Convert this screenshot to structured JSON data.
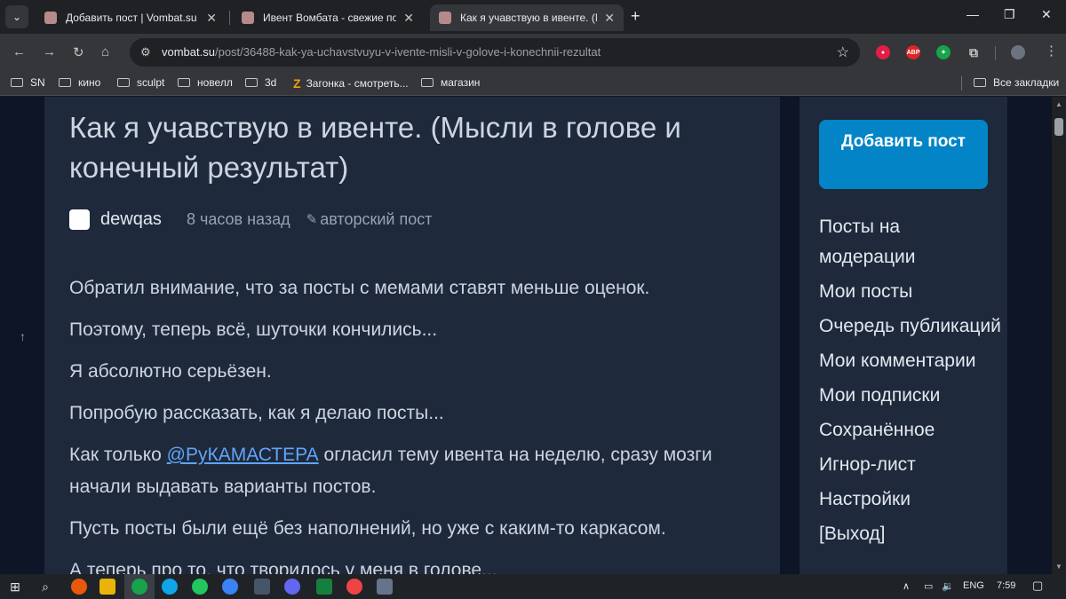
{
  "browser": {
    "tabs": [
      {
        "title": "Добавить пост | Vombat.su",
        "active": false
      },
      {
        "title": "Ивент Вомбата - свежие посты",
        "active": false
      },
      {
        "title": "Как я учавствую в ивенте. (Мыс",
        "active": true
      }
    ],
    "url_host": "vombat.su",
    "url_path": "/post/36488-kak-ya-uchavstvuyu-v-ivente-misli-v-golove-i-konechnii-rezultat",
    "bookmarks": [
      "SN",
      "кино",
      "sculpt",
      "новелл",
      "3d",
      "Загонка - смотреть...",
      "магазин"
    ],
    "all_bookmarks": "Все закладки",
    "extensions": [
      "ABP"
    ]
  },
  "post": {
    "title": "Как я учавствую в ивенте. (Мысли в голове и конечный результат)",
    "author": "dewqas",
    "time": "8 часов назад",
    "badge": "авторский пост",
    "paragraphs": {
      "p1": "Обратил внимание, что за посты с мемами ставят меньше оценок.",
      "p2": "Поэтому, теперь всё, шуточки кончились...",
      "p3": "Я абсолютно серьёзен.",
      "p4": "Попробую рассказать, как я делаю посты...",
      "p5_before": "Как только ",
      "p5_link": "@РуКАМАСТЕРА",
      "p5_after": " огласил тему ивента на неделю, сразу мозги начали выдавать варианты постов.",
      "p6": "Пусть посты были ещё без наполнений, но уже с каким-то каркасом.",
      "p7": "А теперь про то, что творилось у меня в голове..."
    }
  },
  "sidebar": {
    "add_post": "Добавить пост",
    "items": [
      "Посты на модерации",
      "Мои посты",
      "Очередь публикаций",
      "Мои комментарии",
      "Мои подписки",
      "Сохранённое",
      "Игнор-лист",
      "Настройки",
      "[Выход]"
    ]
  },
  "taskbar": {
    "lang": "ENG",
    "time": "7:59"
  },
  "colors": {
    "page_bg": "#0d1526",
    "card_bg": "#1e293b",
    "accent_button": "#0284c7",
    "link": "#60a5fa"
  }
}
